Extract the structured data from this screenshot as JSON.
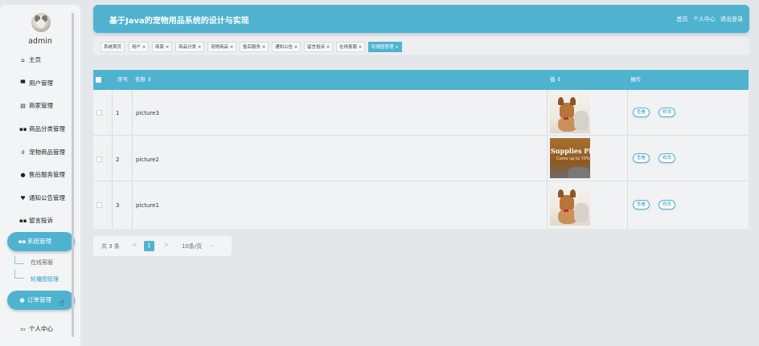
{
  "app_title": "基于Java的宠物用品系统的设计与实现",
  "header_links": [
    "首页",
    "个人中心",
    "退出登录"
  ],
  "user": {
    "name": "admin"
  },
  "sidebar": {
    "items": [
      {
        "label": "主页",
        "icon": "home-icon"
      },
      {
        "label": "用户管理",
        "icon": "monitor-icon"
      },
      {
        "label": "商家管理",
        "icon": "document-icon"
      },
      {
        "label": "商品分类管理",
        "icon": "grid-icon"
      },
      {
        "label": "宠物商品管理",
        "icon": "bar-chart-icon"
      },
      {
        "label": "售后服务管理",
        "icon": "person-icon"
      },
      {
        "label": "通知公告管理",
        "icon": "trophy-icon"
      },
      {
        "label": "留言投诉",
        "icon": "grid-icon"
      },
      {
        "label": "系统管理",
        "icon": "grid-icon",
        "expanded": true
      },
      {
        "label": "订单管理",
        "icon": "person-icon"
      },
      {
        "label": "个人中心",
        "icon": "window-icon"
      }
    ],
    "sub_items": [
      {
        "label": "在线客服",
        "active": false
      },
      {
        "label": "轮播图管理",
        "active": true
      }
    ]
  },
  "tabs": [
    {
      "label": "系统首页",
      "closable": false,
      "active": false
    },
    {
      "label": "用户",
      "closable": true,
      "active": false
    },
    {
      "label": "商家",
      "closable": true,
      "active": false
    },
    {
      "label": "商品分类",
      "closable": true,
      "active": false
    },
    {
      "label": "宠物商品",
      "closable": true,
      "active": false
    },
    {
      "label": "售后服务",
      "closable": true,
      "active": false
    },
    {
      "label": "通知公告",
      "closable": true,
      "active": false
    },
    {
      "label": "留言投诉",
      "closable": true,
      "active": false
    },
    {
      "label": "在线客服",
      "closable": true,
      "active": false
    },
    {
      "label": "轮播图管理",
      "closable": true,
      "active": true
    }
  ],
  "table": {
    "headers": {
      "index": "序号",
      "name": "名称 ⇕",
      "value": "值 ⇕",
      "actions": "操作"
    },
    "rows": [
      {
        "index": "1",
        "name": "picture3",
        "image": "dog-cat"
      },
      {
        "index": "2",
        "name": "picture2",
        "image": "supplies"
      },
      {
        "index": "3",
        "name": "picture1",
        "image": "dog-cat"
      }
    ],
    "view_label": "查看",
    "edit_label": "修改",
    "image_text_1": "Supplies Plu",
    "image_text_2": "Come up to 70%"
  },
  "pagination": {
    "total": "共 3 条",
    "prev": "<",
    "current_page": "1",
    "next": ">",
    "page_size": "10条/页",
    "caret": "⌄"
  },
  "colors": {
    "accent": "#4fb3d0",
    "background": "#e4e7ea"
  }
}
